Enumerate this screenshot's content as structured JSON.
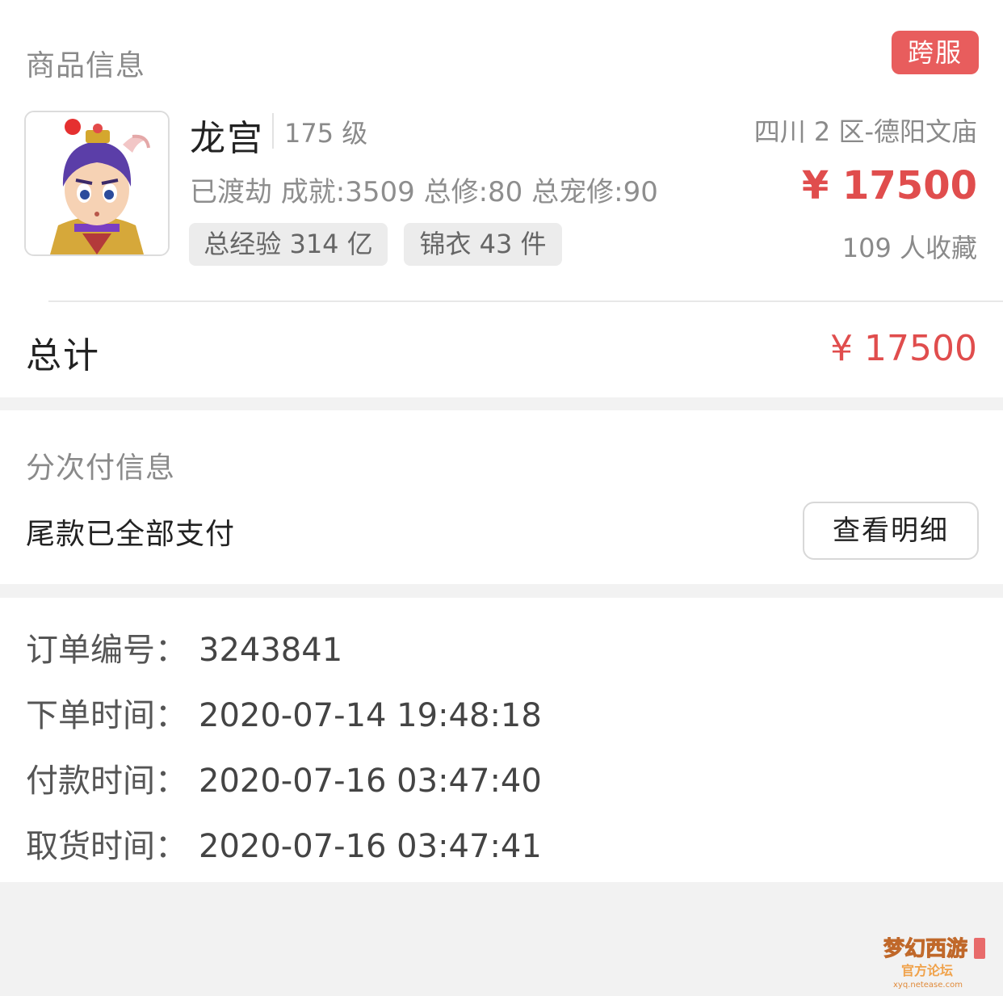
{
  "goods": {
    "section_title": "商品信息",
    "cross_server_badge": "跨服",
    "role_name": "龙宫",
    "level": "175 级",
    "server": "四川 2 区-德阳文庙",
    "stats": "已渡劫 成就:3509 总修:80 总宠修:90",
    "price": "¥ 17500",
    "tags": [
      "总经验 314 亿",
      "锦衣 43 件"
    ],
    "favorites": "109 人收藏",
    "total_label": "总计",
    "total_value": "¥ 17500"
  },
  "installment": {
    "section_title": "分次付信息",
    "status": "尾款已全部支付",
    "detail_button": "查看明细"
  },
  "order": {
    "rows": [
      {
        "label": "订单编号：",
        "value": "3243841"
      },
      {
        "label": "下单时间：",
        "value": "2020-07-14 19:48:18"
      },
      {
        "label": "付款时间：",
        "value": "2020-07-16 03:47:40"
      },
      {
        "label": "取货时间：",
        "value": "2020-07-16 03:47:41"
      }
    ]
  },
  "colors": {
    "accent_red": "#e04d4d",
    "badge_red": "#e85d5d",
    "tag_bg": "#ececec",
    "page_bg": "#f2f2f2"
  },
  "watermark": {
    "logo_text": "梦幻西游",
    "sub_text": "官方论坛",
    "url_text": "xyq.netease.com"
  },
  "icons": {
    "avatar": "character-portrait-icon",
    "watermark": "game-forum-logo-icon"
  }
}
